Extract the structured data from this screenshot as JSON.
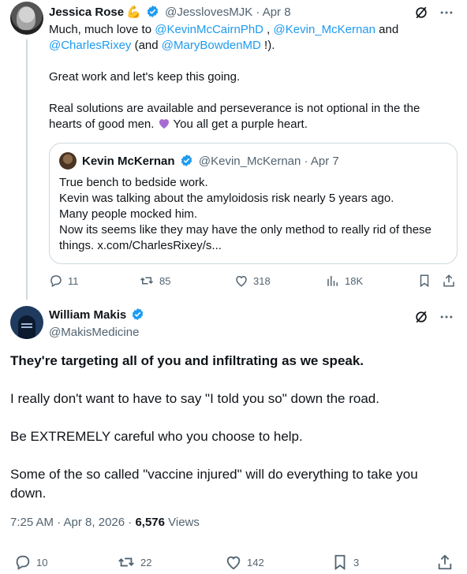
{
  "tweet1": {
    "author_name": "Jessica Rose",
    "emoji": "💪",
    "handle": "@JesslovesMJK",
    "date": "· Apr 8",
    "body": {
      "l1_a": "Much, much love to ",
      "m1": "@KevinMcCairnPhD",
      "l1_b": " , ",
      "m2": "@Kevin_McKernan",
      "l1_c": " and",
      "m3": "@CharlesRixey",
      "l2_a": " (and ",
      "m4": "@MaryBowdenMD",
      "l2_b": " !).",
      "p2": "Great work and let's keep this going.",
      "p3_a": "Real solutions are available and perseverance is not optional in the the hearts of good men. ",
      "p3_b": " You all get a purple heart."
    },
    "quote": {
      "author_name": "Kevin McKernan",
      "handle": "@Kevin_McKernan",
      "date": "· Apr 7",
      "lines": [
        "True bench to bedside work.",
        "Kevin was talking about the amyloidosis risk nearly 5 years ago.",
        "Many people mocked him.",
        "Now its seems like they may have the only method to really rid of these",
        "things. x.com/CharlesRixey/s..."
      ]
    },
    "actions": {
      "replies": "11",
      "reposts": "85",
      "likes": "318",
      "views": "18K"
    }
  },
  "tweet2": {
    "author_name": "William Makis",
    "handle": "@MakisMedicine",
    "body": {
      "p1": "They're targeting all of you and infiltrating as we speak.",
      "p2": "I really don't want to have to say \"I told you so\" down the road.",
      "p3": "Be EXTREMELY careful who you choose to help.",
      "p4": "Some of the so called \"vaccine injured\" will do everything to take you down."
    },
    "meta": {
      "time": "7:25 AM · Apr 8, 2026 · ",
      "views_count": "6,576",
      "views_label": " Views"
    },
    "actions": {
      "replies": "10",
      "reposts": "22",
      "likes": "142",
      "bookmarks": "3"
    }
  },
  "colors": {
    "accent": "#1d9bf0",
    "muted": "#536471",
    "text": "#0f1419",
    "border": "#cfd9de",
    "heart": "#a66bd3"
  }
}
